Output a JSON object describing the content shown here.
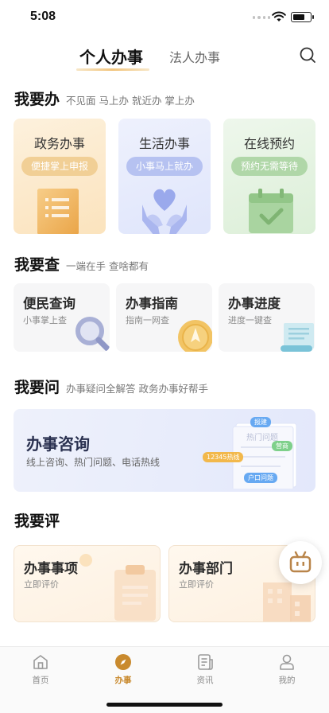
{
  "status": {
    "time": "5:08",
    "battery_level": 0.75
  },
  "tabs": {
    "personal": "个人办事",
    "legal": "法人办事"
  },
  "section_do": {
    "title": "我要办",
    "subtitle": "不见面 马上办 就近办 掌上办",
    "cards": [
      {
        "title": "政务办事",
        "pill": "便捷掌上申报",
        "icon": "document-icon"
      },
      {
        "title": "生活办事",
        "pill": "小事马上就办",
        "icon": "heart-hands-icon"
      },
      {
        "title": "在线预约",
        "pill": "预约无需等待",
        "icon": "calendar-check-icon"
      }
    ]
  },
  "section_query": {
    "title": "我要查",
    "subtitle": "一端在手 查啥都有",
    "cards": [
      {
        "title": "便民查询",
        "sub": "小事掌上查",
        "icon": "magnifier-icon"
      },
      {
        "title": "办事指南",
        "sub": "指南一网查",
        "icon": "compass-icon"
      },
      {
        "title": "办事进度",
        "sub": "进度一键查",
        "icon": "scroll-icon"
      }
    ]
  },
  "section_ask": {
    "title": "我要问",
    "subtitle": "办事疑问全解答 政务办事好帮手",
    "banner_title": "办事咨询",
    "banner_sub": "线上咨询、热门问题、电话热线",
    "doc_heading": "热门问题",
    "tags": {
      "t1": "报建",
      "t2": "营商",
      "t3": "12345热线",
      "t4": "户口问题"
    }
  },
  "section_eval": {
    "title": "我要评",
    "cards": [
      {
        "title": "办事事项",
        "sub": "立即评价",
        "icon": "clipboard-icon"
      },
      {
        "title": "办事部门",
        "sub": "立即评价",
        "icon": "building-icon"
      }
    ]
  },
  "nav": {
    "home": "首页",
    "work": "办事",
    "news": "资讯",
    "mine": "我的",
    "active": "work"
  },
  "colors": {
    "accent": "#c98a2e",
    "tab_underline": "#f2c57e"
  }
}
